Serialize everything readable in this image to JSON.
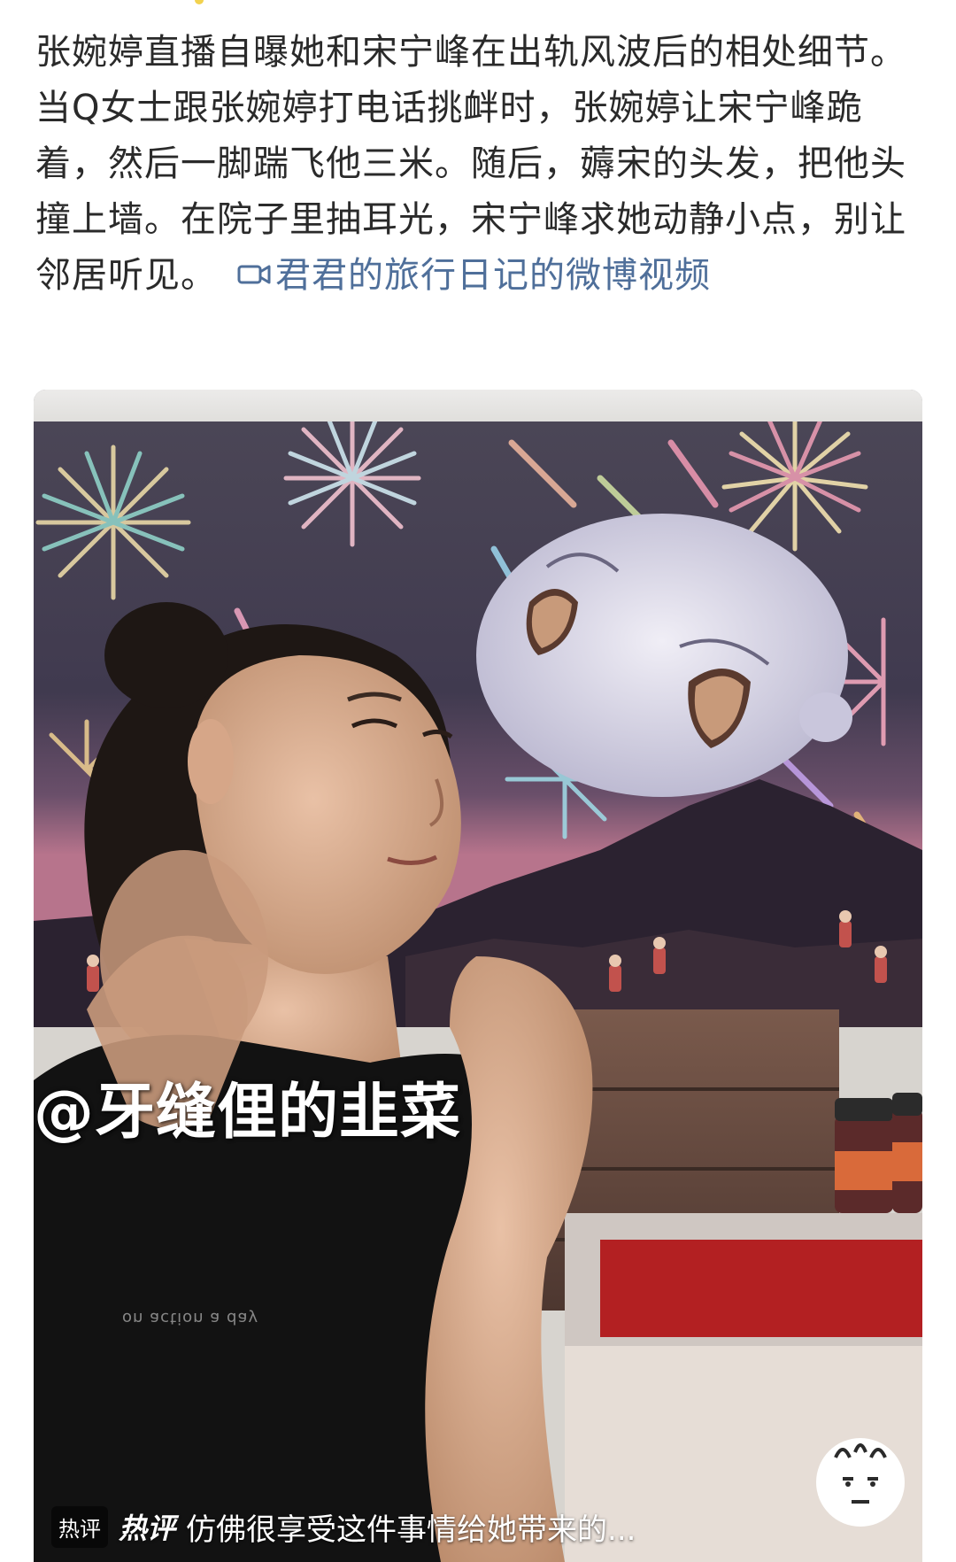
{
  "post": {
    "text": "张婉婷直播自曝她和宋宁峰在出轨风波后的相处细节。当Q女士跟张婉婷打电话挑衅时，张婉婷让宋宁峰跪着，然后一脚踹飞他三米。随后，薅宋的头发，把他头撞上墙。在院子里抽耳光，宋宁峰求她动静小点，别让邻居听见。",
    "video_link_label": "君君的旅行日记的微博视频",
    "link_color": "#4f6f9a"
  },
  "media": {
    "watermark": "@牙缝俚的韭菜",
    "shirt_print": "on action a day",
    "hot_comment": {
      "badge": "热评",
      "tag": "热评",
      "text": "仿佛很享受这件事情给她带来的..."
    }
  },
  "icons": {
    "video_link_icon": "video-camera-icon",
    "sticker": "sticker-face-icon"
  }
}
